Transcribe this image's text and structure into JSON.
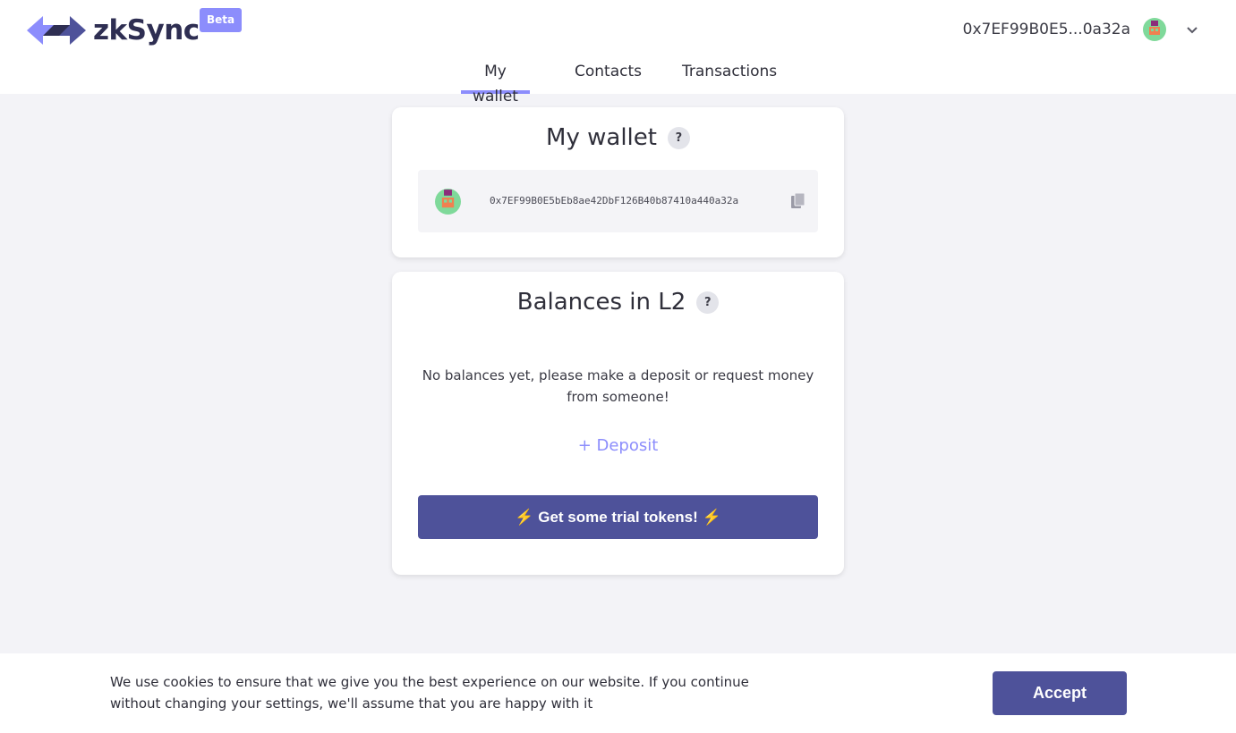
{
  "header": {
    "brand": "zkSync",
    "badge": "Beta",
    "account_address_short": "0x7EF99B0E5...0a32a"
  },
  "nav": {
    "tabs": [
      {
        "label": "My wallet",
        "active": true
      },
      {
        "label": "Contacts",
        "active": false
      },
      {
        "label": "Transactions",
        "active": false
      }
    ]
  },
  "wallet_card": {
    "title": "My wallet",
    "help": "?",
    "address_full": "0x7EF99B0E5bEb8ae42DbF126B40b87410a440a32a"
  },
  "balances_card": {
    "title": "Balances in L2",
    "help": "?",
    "empty_message": "No balances yet, please make a deposit or request money from someone!",
    "deposit_label": "+ Deposit",
    "trial_label": "Get some trial tokens!",
    "trial_emoji": "⚡"
  },
  "cookie": {
    "message": "We use cookies to ensure that we give you the best experience on our website. If you continue without changing your settings, we'll assume that you are happy with it",
    "accept_label": "Accept"
  },
  "colors": {
    "accent": "#8c8dfc",
    "primary_button": "#4e529a",
    "background": "#f3f3f7"
  }
}
